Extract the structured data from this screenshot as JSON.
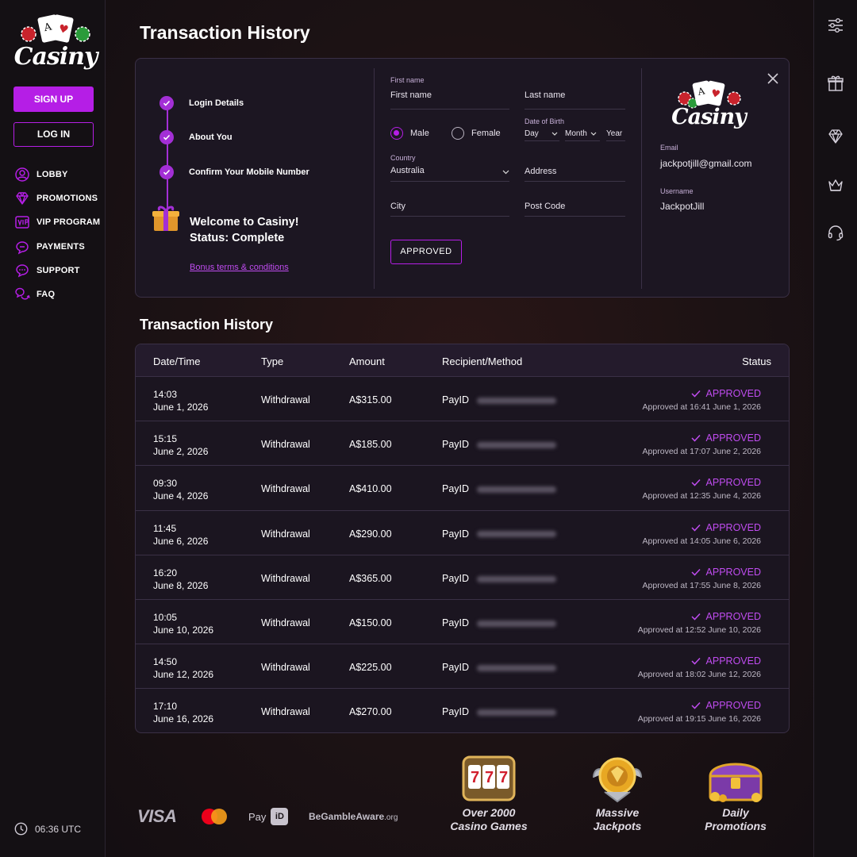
{
  "app": {
    "brand": "Casiny"
  },
  "sidebar": {
    "signup_label": "SIGN UP",
    "login_label": "LOG IN",
    "items": [
      {
        "label": "LOBBY",
        "icon": "lobby-icon"
      },
      {
        "label": "PROMOTIONS",
        "icon": "diamond-icon"
      },
      {
        "label": "VIP PROGRAM",
        "icon": "vip-icon"
      },
      {
        "label": "PAYMENTS",
        "icon": "payments-icon"
      },
      {
        "label": "SUPPORT",
        "icon": "support-icon"
      },
      {
        "label": "FAQ",
        "icon": "faq-icon"
      }
    ],
    "clock": "06:36 UTC"
  },
  "rail": {
    "icons": [
      "filters-icon",
      "gift-icon",
      "diamond-icon",
      "crown-icon",
      "headset-icon"
    ]
  },
  "page": {
    "title": "Transaction History"
  },
  "registration": {
    "steps": [
      {
        "label": "Login Details",
        "done": true
      },
      {
        "label": "About You",
        "done": true
      },
      {
        "label": "Confirm Your Mobile Number",
        "done": true
      }
    ],
    "welcome_line1": "Welcome to Casiny!",
    "welcome_line2": "Status: Complete",
    "bonus_link": "Bonus terms & conditions",
    "first_name_label": "First name",
    "first_name_value": "First name",
    "last_name_value": "Last name",
    "gender_male": "Male",
    "gender_female": "Female",
    "gender_selected": "Male",
    "dob_label": "Date of Birth",
    "dob_day": "Day",
    "dob_month": "Month",
    "dob_year": "Year",
    "country_label": "Country",
    "country_value": "Australia",
    "address": "Address",
    "city": "City",
    "post_code": "Post Code",
    "approved_button": "APPROVED",
    "email_label": "Email",
    "email_value": "jackpotjill@gmail.com",
    "username_label": "Username",
    "username_value": "JackpotJill"
  },
  "transactions": {
    "title": "Transaction History",
    "columns": [
      "Date/Time",
      "Type",
      "Amount",
      "Recipient/Method",
      "Status"
    ],
    "rows": [
      {
        "time": "14:03",
        "date": "June 1, 2026",
        "type": "Withdrawal",
        "amount": "A$315.00",
        "method": "PayID",
        "status": "APPROVED",
        "approved_at": "Approved at 16:41 June 1, 2026"
      },
      {
        "time": "15:15",
        "date": "June 2, 2026",
        "type": "Withdrawal",
        "amount": "A$185.00",
        "method": "PayID",
        "status": "APPROVED",
        "approved_at": "Approved at 17:07 June 2, 2026"
      },
      {
        "time": "09:30",
        "date": "June 4, 2026",
        "type": "Withdrawal",
        "amount": "A$410.00",
        "method": "PayID",
        "status": "APPROVED",
        "approved_at": "Approved at 12:35 June 4, 2026"
      },
      {
        "time": "11:45",
        "date": "June 6, 2026",
        "type": "Withdrawal",
        "amount": "A$290.00",
        "method": "PayID",
        "status": "APPROVED",
        "approved_at": "Approved at 14:05 June 6, 2026"
      },
      {
        "time": "16:20",
        "date": "June 8, 2026",
        "type": "Withdrawal",
        "amount": "A$365.00",
        "method": "PayID",
        "status": "APPROVED",
        "approved_at": "Approved at 17:55 June 8, 2026"
      },
      {
        "time": "10:05",
        "date": "June 10, 2026",
        "type": "Withdrawal",
        "amount": "A$150.00",
        "method": "PayID",
        "status": "APPROVED",
        "approved_at": "Approved at 12:52 June 10, 2026"
      },
      {
        "time": "14:50",
        "date": "June 12, 2026",
        "type": "Withdrawal",
        "amount": "A$225.00",
        "method": "PayID",
        "status": "APPROVED",
        "approved_at": "Approved at 18:02 June 12, 2026"
      },
      {
        "time": "17:10",
        "date": "June 16, 2026",
        "type": "Withdrawal",
        "amount": "A$270.00",
        "method": "PayID",
        "status": "APPROVED",
        "approved_at": "Approved at 19:15 June 16, 2026"
      }
    ]
  },
  "footer": {
    "visa": "VISA",
    "payid": "Pay",
    "payid_badge": "iD",
    "begambleaware": "BeGambleAware",
    "begambleaware_suffix": ".org",
    "promos": [
      {
        "line1": "Over 2000",
        "line2": "Casino Games",
        "icon": "slot-machine-icon"
      },
      {
        "line1": "Massive",
        "line2": "Jackpots",
        "icon": "jackpot-medal-icon"
      },
      {
        "line1": "Daily",
        "line2": "Promotions",
        "icon": "treasure-chest-icon"
      }
    ]
  },
  "colors": {
    "accent": "#b51ee6",
    "status_approved": "#c04cf0",
    "background": "#151015"
  }
}
